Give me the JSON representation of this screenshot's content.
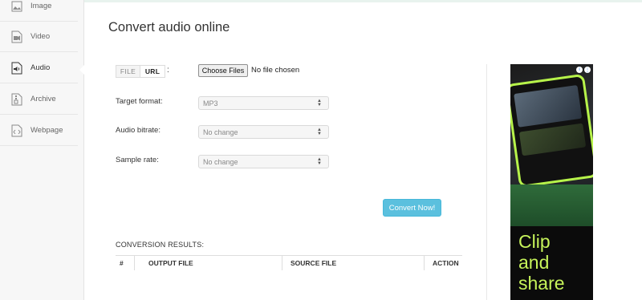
{
  "sidebar": {
    "items": [
      {
        "label": "Image",
        "icon": "image-icon"
      },
      {
        "label": "Video",
        "icon": "video-icon"
      },
      {
        "label": "Audio",
        "icon": "audio-icon",
        "active": true
      },
      {
        "label": "Archive",
        "icon": "archive-icon"
      },
      {
        "label": "Webpage",
        "icon": "webpage-icon"
      }
    ]
  },
  "main": {
    "title": "Convert audio online",
    "tabs": {
      "file": "FILE",
      "url": "URL",
      "colon": ":"
    },
    "file_input": {
      "button": "Choose Files",
      "status": "No file chosen"
    },
    "form": {
      "target_format": {
        "label": "Target format:",
        "value": "MP3"
      },
      "audio_bitrate": {
        "label": "Audio bitrate:",
        "value": "No change"
      },
      "sample_rate": {
        "label": "Sample rate:",
        "value": "No change"
      }
    },
    "convert_button": "Convert Now!",
    "results": {
      "title": "CONVERSION RESULTS:",
      "columns": [
        "#",
        "OUTPUT FILE",
        "SOURCE FILE",
        "ACTION"
      ]
    }
  },
  "ad": {
    "text_line1": "Clip",
    "text_line2": "and",
    "text_line3": "share",
    "accent_color": "#c6f35a"
  },
  "colors": {
    "convert_button": "#5bc0de",
    "sidebar_bg": "#f7f7f7"
  }
}
